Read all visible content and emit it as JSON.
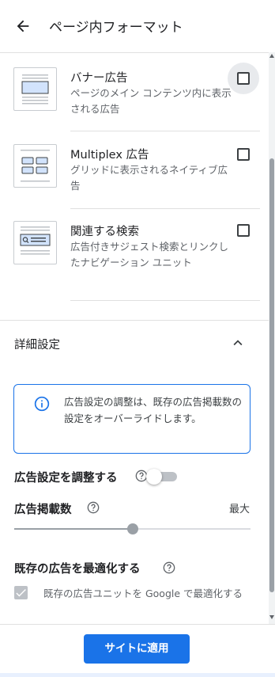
{
  "header": {
    "title": "ページ内フォーマット"
  },
  "formats": [
    {
      "title": "バナー広告",
      "description": "ページのメイン コンテンツ内に表示される広告",
      "checked": false
    },
    {
      "title": "Multiplex 広告",
      "description": "グリッドに表示されるネイティブ広告",
      "checked": false
    },
    {
      "title": "関連する検索",
      "description": "広告付きサジェスト検索とリンクしたナビゲーション ユニット",
      "checked": false
    }
  ],
  "advanced": {
    "title": "詳細設定",
    "info": "広告設定の調整は、既存の広告掲載数の設定をオーバーライドします。",
    "adjust_label": "広告設定を調整する",
    "adjust_enabled": false,
    "density_label": "広告掲載数",
    "density_max_label": "最大",
    "density_level": 0.5,
    "optimize_label": "既存の広告を最適化する",
    "optimize_checkbox_label": "既存の広告ユニットを Google で最適化する",
    "optimize_checked": true
  },
  "footer": {
    "apply_label": "サイトに適用"
  },
  "colors": {
    "accent": "#1a73e8",
    "disabled": "#bdc1c6"
  }
}
